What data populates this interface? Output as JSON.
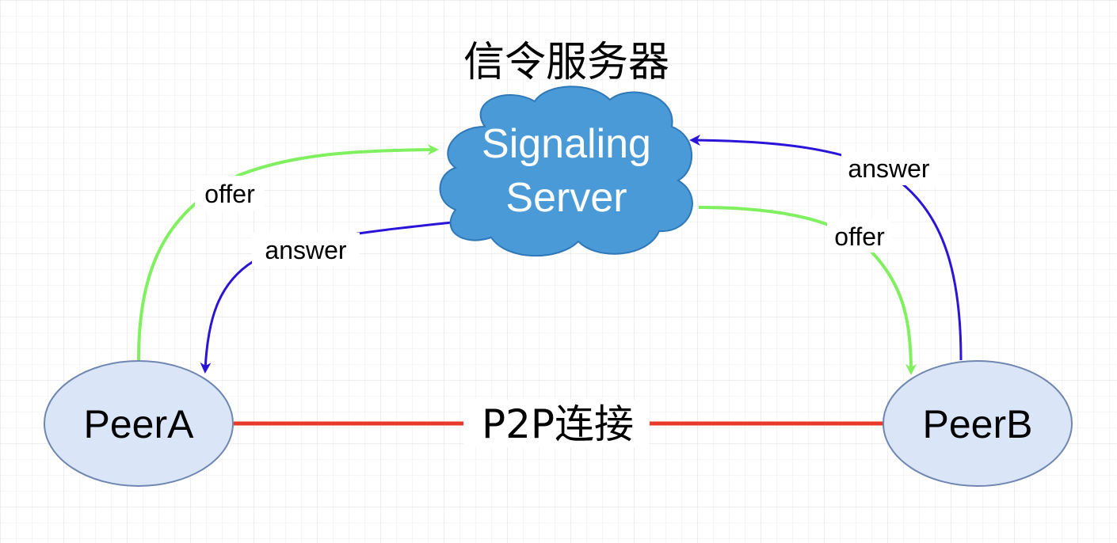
{
  "title": "信令服务器",
  "server": {
    "line1": "Signaling",
    "line2": "Server"
  },
  "peers": {
    "a": "PeerA",
    "b": "PeerB"
  },
  "edges": {
    "a_offer": "offer",
    "a_answer": "answer",
    "b_offer": "offer",
    "b_answer": "answer",
    "p2p": "P2P连接"
  },
  "colors": {
    "offer": "#80f060",
    "answer": "#2a14d8",
    "p2p": "#e8392a",
    "cloud_fill": "#4a9ad8",
    "cloud_stroke": "#2e78b8",
    "peer_fill": "#dae6f8",
    "peer_stroke": "#6f86b0",
    "grid": "#e6e6e6"
  }
}
